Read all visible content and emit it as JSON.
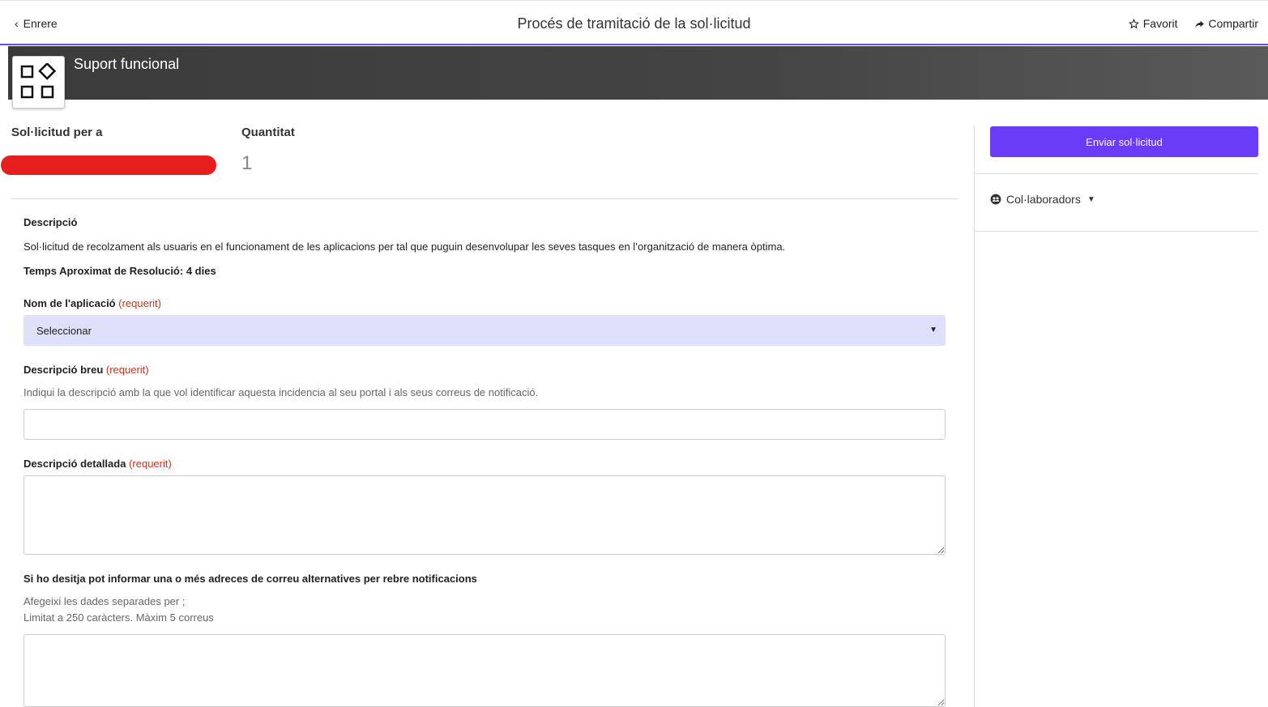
{
  "header": {
    "back_label": "Enrere",
    "title": "Procés de tramitació de la sol·licitud",
    "favorite_label": "Favorit",
    "share_label": "Compartir",
    "accent_color": "#6b4ee6"
  },
  "banner": {
    "title": "Suport funcional",
    "icon": "apps-grid-icon"
  },
  "request": {
    "for_label": "Sol·licitud per a",
    "quantity_label": "Quantitat",
    "quantity_value": "1"
  },
  "description": {
    "heading": "Descripció",
    "body": "Sol·licitud de recolzament als usuaris en el funcionament de les aplicacions per tal que puguin desenvolupar les seves tasques en l’organització de manera òptima.",
    "resolution_time": "Temps Aproximat de Resolució: 4 dies"
  },
  "form": {
    "app_name": {
      "label": "Nom de l'aplicació",
      "required": "(requerit)",
      "value": "Seleccionar"
    },
    "short_desc": {
      "label": "Descripció breu",
      "required": "(requerit)",
      "hint": "Indiqui la descripció amb la que vol identificar aquesta incidencia al seu portal i als seus correus de notificació.",
      "value": ""
    },
    "detailed_desc": {
      "label": "Descripció detallada",
      "required": "(requerit)",
      "value": ""
    },
    "alt_emails": {
      "label": "Si ho desitja pot informar una o més adreces de correu alternatives per rebre notificacions",
      "hint1": "Afegeixi les dades separades per ;",
      "hint2": "Limitat a 250 caràcters. Màxim 5 correus",
      "value": ""
    }
  },
  "sidebar": {
    "submit_label": "Enviar sol·licitud",
    "submit_color": "#6a3cf5",
    "collaborators_label": "Col·laboradors"
  }
}
